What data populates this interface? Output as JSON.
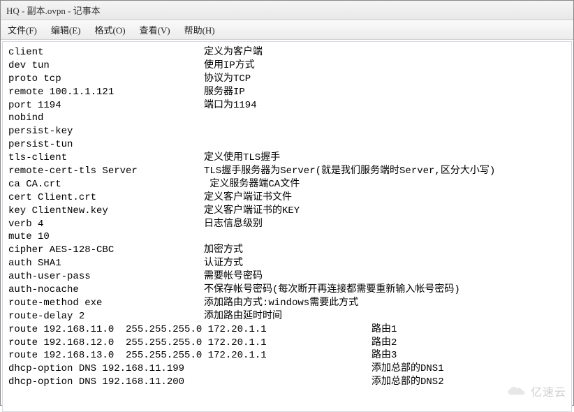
{
  "title": "HQ - 副本.ovpn - 记事本",
  "menu": {
    "file": "文件(F)",
    "edit": "编辑(E)",
    "format": "格式(O)",
    "view": "查看(V)",
    "help": "帮助(H)"
  },
  "lines": [
    {
      "cfg": "client",
      "desc": "定义为客户端"
    },
    {
      "cfg": "dev tun",
      "desc": "使用IP方式"
    },
    {
      "cfg": "proto tcp",
      "desc": "协议为TCP"
    },
    {
      "cfg": "remote 100.1.1.121",
      "desc": "服务器IP"
    },
    {
      "cfg": "port 1194",
      "desc": "端口为1194"
    },
    {
      "cfg": "nobind",
      "desc": ""
    },
    {
      "cfg": "persist-key",
      "desc": ""
    },
    {
      "cfg": "persist-tun",
      "desc": ""
    },
    {
      "cfg": "tls-client",
      "desc": "定义使用TLS握手"
    },
    {
      "cfg": "remote-cert-tls Server",
      "desc": "TLS握手服务器为Server(就是我们服务端时Server,区分大小写)"
    },
    {
      "cfg": "ca CA.crt",
      "desc": " 定义服务器端CA文件"
    },
    {
      "cfg": "cert Client.crt",
      "desc": "定义客户端证书文件"
    },
    {
      "cfg": "key ClientNew.key",
      "desc": "定义客户端证书的KEY"
    },
    {
      "cfg": "verb 4",
      "desc": "日志信息级别"
    },
    {
      "cfg": "mute 10",
      "desc": ""
    },
    {
      "cfg": "cipher AES-128-CBC",
      "desc": "加密方式"
    },
    {
      "cfg": "auth SHA1",
      "desc": "认证方式"
    },
    {
      "cfg": "auth-user-pass",
      "desc": "需要帐号密码"
    },
    {
      "cfg": "auth-nocache",
      "desc": "不保存帐号密码(每次断开再连接都需要重新输入帐号密码)"
    },
    {
      "cfg": "route-method exe",
      "desc": "添加路由方式:windows需要此方式"
    },
    {
      "cfg": "route-delay 2",
      "desc": "添加路由延时时间"
    }
  ],
  "routes": [
    {
      "cfg": "route 192.168.11.0  255.255.255.0 172.20.1.1",
      "desc": "路由1"
    },
    {
      "cfg": "route 192.168.12.0  255.255.255.0 172.20.1.1",
      "desc": "路由2"
    },
    {
      "cfg": "route 192.168.13.0  255.255.255.0 172.20.1.1",
      "desc": "路由3"
    },
    {
      "cfg": "dhcp-option DNS 192.168.11.199",
      "desc": "添加总部的DNS1"
    },
    {
      "cfg": "dhcp-option DNS 192.168.11.200",
      "desc": "添加总部的DNS2"
    }
  ],
  "watermark": "亿速云"
}
